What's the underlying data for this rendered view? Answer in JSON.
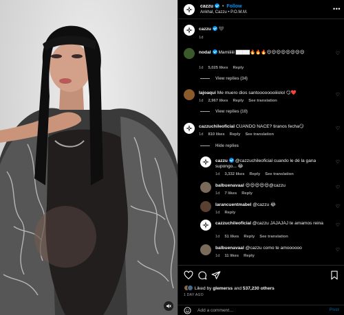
{
  "header": {
    "username": "cazzu",
    "follow_label": "Follow",
    "subtitle": "Ankhal, Cazzu • P.O.M.M.",
    "more_glyph": "•••"
  },
  "caption": {
    "username": "cazzu",
    "text": "🖤",
    "time": "1d"
  },
  "comments": [
    {
      "username": "nodal",
      "text": "Mamiiiiii ▇▇▇▇🔥🔥🔥😍😍😍😍😍😍😍😍",
      "time": "1d",
      "likes": "5,025 likes",
      "reply": "Reply",
      "view_replies": "View replies (34)"
    },
    {
      "username": "lajoaqui",
      "text": "Me muero dios santoooooooiiiolol 😏❤️",
      "time": "1d",
      "likes": "2,967 likes",
      "reply": "Reply",
      "translation": "See translation",
      "view_replies": "View replies (10)"
    },
    {
      "username": "cazzuchileoficial",
      "text": "CUANDO NACE? tiranos fecha😏",
      "time": "1d",
      "likes": "810 likes",
      "reply": "Reply",
      "translation": "See translation",
      "hide_replies": "Hide replies"
    }
  ],
  "replies": [
    {
      "username": "cazzu",
      "text": "@cazzuchileoficial cuando le dé la gana supongo... 😂",
      "time": "1d",
      "likes": "3,332 likes",
      "reply": "Reply",
      "translation": "See translation"
    },
    {
      "username": "balbuenavaal",
      "text": "😍😍😍😍😍@cazzu",
      "time": "1d",
      "likes": "7 likes",
      "reply": "Reply"
    },
    {
      "username": "larancuentmabel",
      "text": "@cazzu 😂",
      "time": "1d",
      "likes": "",
      "reply": "Reply"
    },
    {
      "username": "cazzuchileoficial",
      "text": "@cazzu JAJAJAJ te amamos reina",
      "time": "1d",
      "likes": "51 likes",
      "reply": "Reply",
      "translation": "See translation"
    },
    {
      "username": "balbuenavaal",
      "text": "@cazzu como te amoooooo",
      "time": "1d",
      "likes": "11 likes",
      "reply": "Reply"
    }
  ],
  "actions": {
    "liked_by_prefix": "Liked by",
    "liked_by_user": "glemerss",
    "liked_by_and": "and",
    "liked_by_count": "537,230 others",
    "date": "1 DAY AGO"
  },
  "add_comment": {
    "placeholder": "Add a comment…",
    "post_label": "Post"
  },
  "icons": {
    "like": "heart-icon",
    "comment": "comment-icon",
    "share": "share-icon",
    "save": "bookmark-icon",
    "mute": "speaker-muted-icon",
    "emoji": "emoji-icon"
  },
  "colors": {
    "accent": "#0095f6",
    "background": "#000000",
    "muted_text": "#a8a8a8"
  }
}
